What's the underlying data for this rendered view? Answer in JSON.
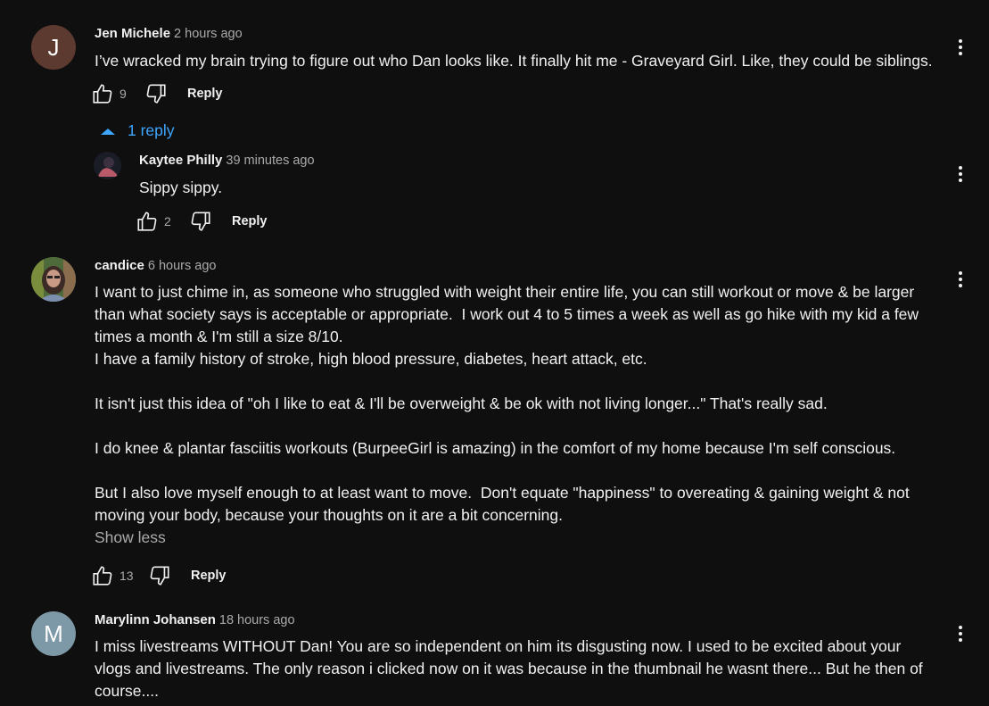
{
  "comments": [
    {
      "avatar_letter": "J",
      "avatar_color": "#5d3a30",
      "author": "Jen Michele",
      "time": "2 hours ago",
      "text": "I’ve wracked my brain trying to figure out who Dan looks like. It finally hit me - Graveyard Girl. Like, they could be siblings.",
      "likes": "9",
      "reply_label": "Reply",
      "replies_label": "1 reply",
      "replies": [
        {
          "author": "Kaytee Philly",
          "time": "39 minutes ago",
          "text": "Sippy sippy.",
          "likes": "2",
          "reply_label": "Reply"
        }
      ]
    },
    {
      "author": "candice",
      "time": "6 hours ago",
      "text": "I want to just chime in, as someone who struggled with weight their entire life, you can still workout or move & be larger than what society says is acceptable or appropriate.  I work out 4 to 5 times a week as well as go hike with my kid a few times a month & I'm still a size 8/10.\nI have a family history of stroke, high blood pressure, diabetes, heart attack, etc.\n\nIt isn't just this idea of \"oh I like to eat & I'll be overweight & be ok with not living longer...\" That's really sad.\n\nI do knee & plantar fasciitis workouts (BurpeeGirl is amazing) in the comfort of my home because I'm self conscious.\n\nBut I also love myself enough to at least want to move.  Don't equate \"happiness\" to overeating & gaining weight & not moving your body, because your thoughts on it are a bit concerning.",
      "show_less": "Show less",
      "likes": "13",
      "reply_label": "Reply"
    },
    {
      "avatar_letter": "M",
      "avatar_color": "#7d98a6",
      "author": "Marylinn Johansen",
      "time": "18 hours ago",
      "text": "I miss livestreams WITHOUT Dan! You are so independent on him its disgusting now. I used to be excited about your vlogs and livestreams. The only reason i clicked now on it was because in the thumbnail he wasnt there... But he then of course...."
    }
  ]
}
